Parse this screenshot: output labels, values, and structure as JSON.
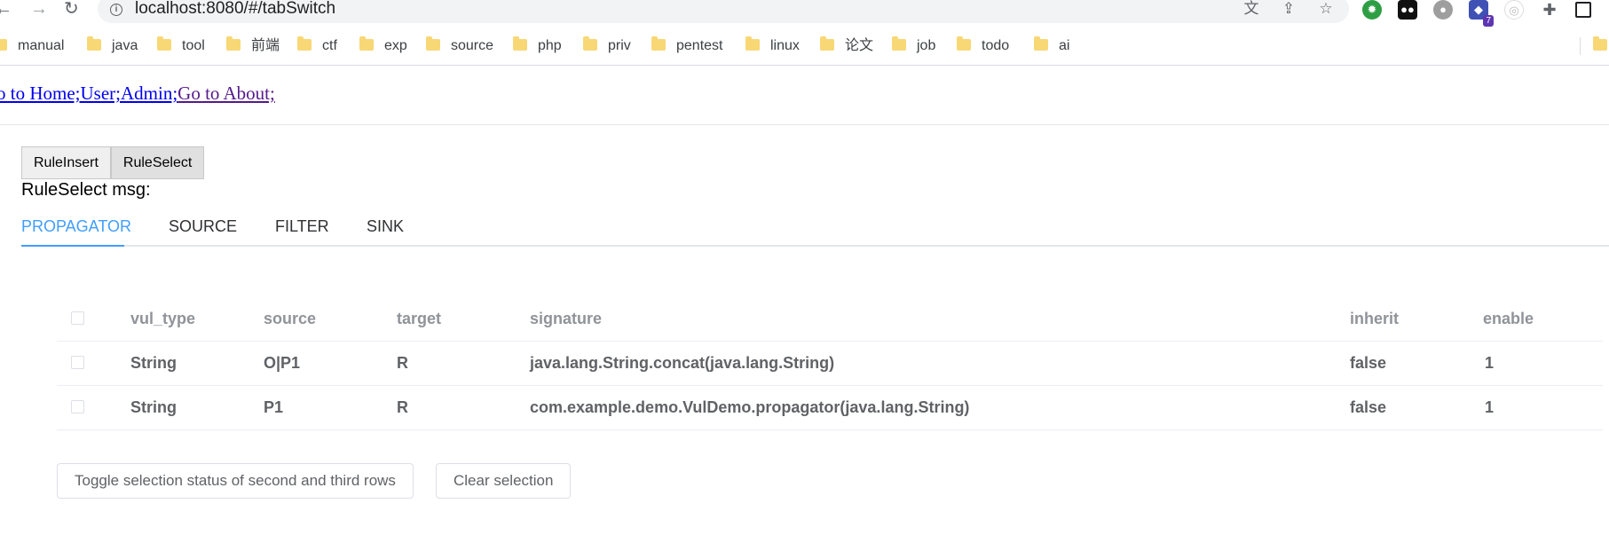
{
  "browser": {
    "url": "localhost:8080/#/tabSwitch",
    "bookmarks": [
      "manual",
      "java",
      "tool",
      "前端",
      "ctf",
      "exp",
      "source",
      "php",
      "priv",
      "pentest",
      "linux",
      "论文",
      "job",
      "todo",
      "ai"
    ],
    "extension_badge": "7"
  },
  "nav_links": {
    "home": "o to Home;",
    "user": "User;",
    "admin": "Admin;",
    "about": "Go to About;"
  },
  "switch_buttons": {
    "insert": "RuleInsert",
    "select": "RuleSelect"
  },
  "message": "RuleSelect msg:",
  "tabs": [
    "PROPAGATOR",
    "SOURCE",
    "FILTER",
    "SINK"
  ],
  "table": {
    "headers": [
      "vul_type",
      "source",
      "target",
      "signature",
      "inherit",
      "enable"
    ],
    "rows": [
      [
        "String",
        "O|P1",
        "R",
        "java.lang.String.concat(java.lang.String)",
        "false",
        "1"
      ],
      [
        "String",
        "P1",
        "R",
        "com.example.demo.VulDemo.propagator(java.lang.String)",
        "false",
        "1"
      ]
    ]
  },
  "actions": {
    "toggle": "Toggle selection status of second and third rows",
    "clear": "Clear selection"
  },
  "colors": {
    "accent": "#409eff",
    "link": "#0000ee",
    "visited_link": "#551a8b"
  }
}
